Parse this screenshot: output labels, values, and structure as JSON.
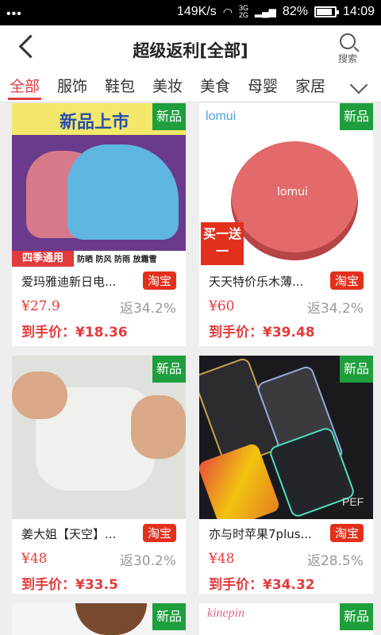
{
  "status_bar": {
    "speed": "149K/s",
    "network": "3G 2G",
    "battery": "82%",
    "time": "14:09"
  },
  "nav": {
    "title": "超级返利[全部]",
    "search_label": "搜索"
  },
  "categories": [
    {
      "label": "全部",
      "active": true
    },
    {
      "label": "服饰"
    },
    {
      "label": "鞋包"
    },
    {
      "label": "美妆"
    },
    {
      "label": "美食"
    },
    {
      "label": "母婴"
    },
    {
      "label": "家居"
    }
  ],
  "products": [
    {
      "title": "爱玛雅迪新日电...",
      "badge": "新品",
      "platform": "淘宝",
      "price": "¥27.9",
      "rebate": "返34.2%",
      "final": "到手价：¥18.36",
      "image": {
        "banner": "新品上市",
        "footer": "四季通用",
        "tags": "防晒 防风 防雨 放霜雪"
      }
    },
    {
      "title": "天天特价乐木薄...",
      "badge": "新品",
      "platform": "淘宝",
      "price": "¥60",
      "rebate": "返34.2%",
      "final": "到手价：¥39.48",
      "image": {
        "logo": "lomui",
        "promo": "买一送一",
        "product_text": "lomui"
      }
    },
    {
      "title": "姜大姐【天空】...",
      "badge": "新品",
      "platform": "淘宝",
      "price": "¥48",
      "rebate": "返30.2%",
      "final": "到手价：¥33.5"
    },
    {
      "title": "亦与时苹果7plus...",
      "badge": "新品",
      "platform": "淘宝",
      "price": "¥48",
      "rebate": "返28.5%",
      "final": "到手价：¥34.32",
      "image": {
        "text": "PEF"
      }
    },
    {
      "badge": "新品"
    },
    {
      "badge": "新品",
      "image": {
        "logo": "kinepin"
      }
    }
  ]
}
